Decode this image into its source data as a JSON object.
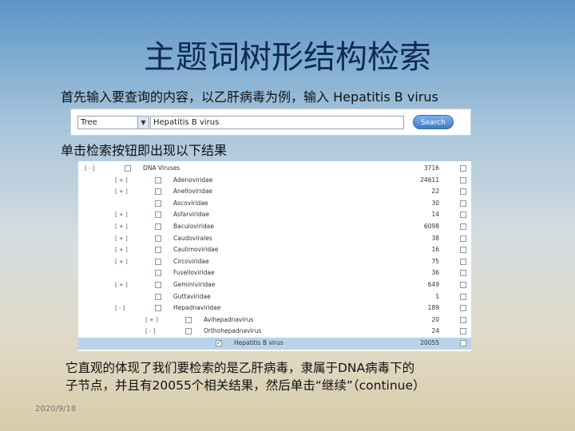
{
  "slide": {
    "title": "主题词树形结构检索",
    "instruction1": "首先输入要查询的内容，以乙肝病毒为例，输入 Hepatitis B virus",
    "instruction2": "单击检索按钮即出现以下结果",
    "description_line1": "它直观的体现了我们要检索的是乙肝病毒，隶属于DNA病毒下的",
    "description_line2": "子节点，并且有20055个相关结果，然后单击“继续”（continue）",
    "date": "2020/9/18"
  },
  "search": {
    "db_selected": "Tree",
    "query_value": "Hepatitis B virus",
    "button_label": "Search"
  },
  "tree": [
    {
      "toggle": "[ - ]",
      "name": "DNA Viruses",
      "count": "3716",
      "level": 0,
      "checked": false
    },
    {
      "toggle": "[ + ]",
      "name": "Adenoviridae",
      "count": "24611",
      "level": 1,
      "checked": false
    },
    {
      "toggle": "[ + ]",
      "name": "Anelloviridae",
      "count": "22",
      "level": 1,
      "checked": false
    },
    {
      "toggle": "",
      "name": "Ascoviridae",
      "count": "30",
      "level": 1,
      "checked": false
    },
    {
      "toggle": "[ + ]",
      "name": "Asfarviridae",
      "count": "14",
      "level": 1,
      "checked": false
    },
    {
      "toggle": "[ + ]",
      "name": "Baculoviridae",
      "count": "6098",
      "level": 1,
      "checked": false
    },
    {
      "toggle": "[ + ]",
      "name": "Caudovirales",
      "count": "38",
      "level": 1,
      "checked": false
    },
    {
      "toggle": "[ + ]",
      "name": "Caulimoviridae",
      "count": "16",
      "level": 1,
      "checked": false
    },
    {
      "toggle": "[ + ]",
      "name": "Circoviridae",
      "count": "75",
      "level": 1,
      "checked": false
    },
    {
      "toggle": "",
      "name": "Fuselloviridae",
      "count": "36",
      "level": 1,
      "checked": false
    },
    {
      "toggle": "[ + ]",
      "name": "Geminiviridae",
      "count": "649",
      "level": 1,
      "checked": false
    },
    {
      "toggle": "",
      "name": "Guttaviridae",
      "count": "1",
      "level": 1,
      "checked": false
    },
    {
      "toggle": "[ - ]",
      "name": "Hepadnaviridae",
      "count": "189",
      "level": 1,
      "checked": false
    },
    {
      "toggle": "[ + ]",
      "name": "Avihepadnavirus",
      "count": "20",
      "level": 2,
      "checked": false
    },
    {
      "toggle": "[ - ]",
      "name": "Orthohepadnavirus",
      "count": "24",
      "level": 2,
      "checked": false
    },
    {
      "toggle": "",
      "name": "Hepatitis B virus",
      "count": "20055",
      "level": 3,
      "checked": true,
      "selected": true
    }
  ]
}
